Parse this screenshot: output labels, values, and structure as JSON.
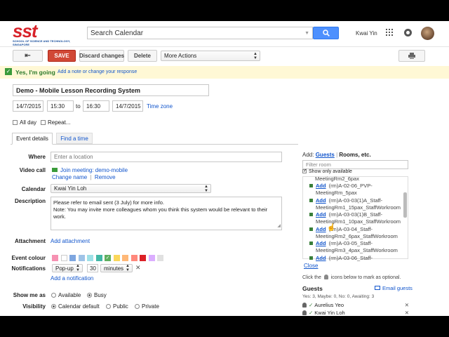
{
  "header": {
    "logo_text": "sst",
    "logo_sub": "SCHOOL OF SCIENCE AND TECHNOLOGY, SINGAPORE",
    "search_placeholder": "Search Calendar",
    "user_name": "Kwai Yin"
  },
  "toolbar": {
    "save_label": "SAVE",
    "discard_label": "Discard changes",
    "delete_label": "Delete",
    "more_actions_label": "More Actions"
  },
  "rsvp": {
    "status_label": "Yes, I'm going",
    "note_link": "Add a note or change your response"
  },
  "event": {
    "title": "Demo - Mobile Lesson Recording System",
    "start_date": "14/7/2015",
    "start_time": "15:30",
    "to_label": "to",
    "end_time": "16:30",
    "end_date": "14/7/2015",
    "timezone_link": "Time zone",
    "all_day_label": "All day",
    "repeat_label": "Repeat..."
  },
  "tabs": {
    "details": "Event details",
    "find_time": "Find a time"
  },
  "form": {
    "where_label": "Where",
    "where_placeholder": "Enter a location",
    "video_label": "Video call",
    "video_link": "Join meeting: demo-mobile",
    "change_name": "Change name",
    "separator": "|",
    "remove": "Remove",
    "calendar_label": "Calendar",
    "calendar_value": "Kwai Yin Loh",
    "description_label": "Description",
    "description_line1": "Please refer to email sent (3 July) for more info.",
    "description_line2": "Note: You may invite more colleagues whom you think this system would be relevant to their work.",
    "attachment_label": "Attachment",
    "attachment_link": "Add attachment",
    "colour_label": "Event colour",
    "notifications_label": "Notifications",
    "notif_type": "Pop-up",
    "notif_amount": "30",
    "notif_unit": "minutes",
    "add_notification": "Add a notification",
    "show_me_label": "Show me as",
    "available": "Available",
    "busy": "Busy",
    "visibility_label": "Visibility",
    "vis_default": "Calendar default",
    "vis_public": "Public",
    "vis_private": "Private"
  },
  "colours": [
    "#f691b2",
    "#ffffff",
    "#7ea6e0",
    "#9fc3e7",
    "#9fe1e7",
    "#42b7a6",
    "#5eaf5e",
    "#fbd75b",
    "#ffb878",
    "#ff887c",
    "#dc2127",
    "#dbadff",
    "#e1e1e1"
  ],
  "rooms": {
    "add_label": "Add:",
    "guests_tab": "Guests",
    "sep": "|",
    "rooms_tab": "Rooms, etc.",
    "filter_placeholder": "Filter room",
    "show_available": "Show only available",
    "list": [
      {
        "l1": "MeetingRm2_6pax",
        "l2": ""
      },
      {
        "add": "Add",
        "l1": "(rm)A-02-06_PVP-",
        "l2": "MeetingRm_5pax"
      },
      {
        "add": "Add",
        "l1": "(rm)A-03-03(1)A_Staff-",
        "l2": "MeetingRm1_15pax_StaffWorkroom"
      },
      {
        "add": "Add",
        "l1": "(rm)A-03-03(1)B_Staff-",
        "l2": "MeetingRm1_10pax_StaffWorkroom"
      },
      {
        "add": "Add",
        "l1": "(rm)A-03-04_Staff-",
        "l2": "MeetingRm2_6pax_StaffWorkroom"
      },
      {
        "add": "Add",
        "l1": "(rm)A-03-05_Staff-",
        "l2": "MeetingRm3_4pax_StaffWorkroom"
      },
      {
        "add": "Add",
        "l1": "(rm)A-03-06_Staff-",
        "l2": ""
      }
    ],
    "close_link": "Close",
    "hint_pre": "Click the",
    "hint_post": "icons below to mark as optional."
  },
  "guests": {
    "title": "Guests",
    "email_link": "Email guests",
    "counts": "Yes: 3, Maybe: 0, No: 0, Awaiting: 3",
    "list": [
      "Aurelius Yeo",
      "Kwai Yin Loh"
    ]
  }
}
